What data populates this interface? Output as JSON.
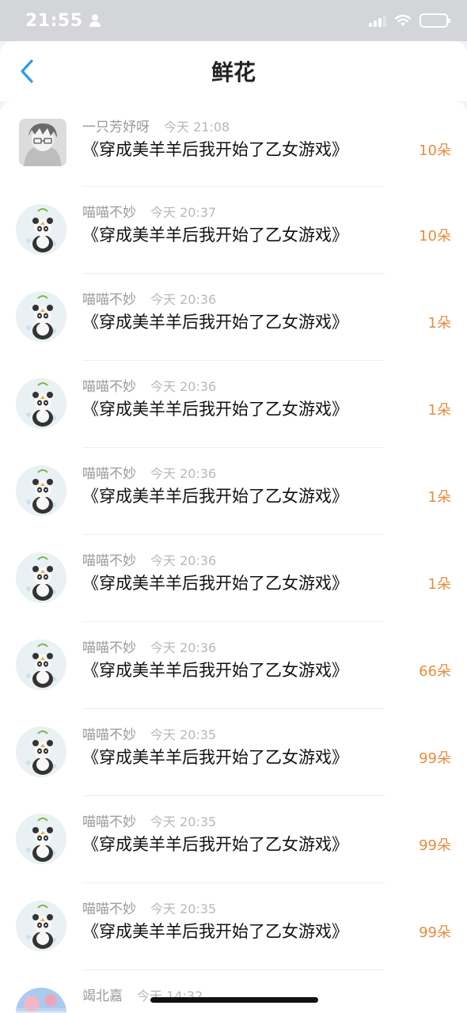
{
  "status_bar": {
    "time": "21:55",
    "battery_color": "#f5cc1b"
  },
  "nav": {
    "title": "鲜花",
    "back_icon": "chevron-left-icon",
    "accent": "#2b9cf0"
  },
  "items": [
    {
      "name": "一只芳妤呀",
      "time": "今天 21:08",
      "book": "《穿成美羊羊后我开始了乙女游戏》",
      "count": "10朵",
      "avatar": "anime-boy-avatar"
    },
    {
      "name": "喵喵不妙",
      "time": "今天 20:37",
      "book": "《穿成美羊羊后我开始了乙女游戏》",
      "count": "10朵",
      "avatar": "panda-avatar"
    },
    {
      "name": "喵喵不妙",
      "time": "今天 20:36",
      "book": "《穿成美羊羊后我开始了乙女游戏》",
      "count": "1朵",
      "avatar": "panda-avatar"
    },
    {
      "name": "喵喵不妙",
      "time": "今天 20:36",
      "book": "《穿成美羊羊后我开始了乙女游戏》",
      "count": "1朵",
      "avatar": "panda-avatar"
    },
    {
      "name": "喵喵不妙",
      "time": "今天 20:36",
      "book": "《穿成美羊羊后我开始了乙女游戏》",
      "count": "1朵",
      "avatar": "panda-avatar"
    },
    {
      "name": "喵喵不妙",
      "time": "今天 20:36",
      "book": "《穿成美羊羊后我开始了乙女游戏》",
      "count": "1朵",
      "avatar": "panda-avatar"
    },
    {
      "name": "喵喵不妙",
      "time": "今天 20:36",
      "book": "《穿成美羊羊后我开始了乙女游戏》",
      "count": "66朵",
      "avatar": "panda-avatar"
    },
    {
      "name": "喵喵不妙",
      "time": "今天 20:35",
      "book": "《穿成美羊羊后我开始了乙女游戏》",
      "count": "99朵",
      "avatar": "panda-avatar"
    },
    {
      "name": "喵喵不妙",
      "time": "今天 20:35",
      "book": "《穿成美羊羊后我开始了乙女游戏》",
      "count": "99朵",
      "avatar": "panda-avatar"
    },
    {
      "name": "喵喵不妙",
      "time": "今天 20:35",
      "book": "《穿成美羊羊后我开始了乙女游戏》",
      "count": "99朵",
      "avatar": "panda-avatar"
    },
    {
      "name": "竭北嘉",
      "time": "今天 14:32",
      "book": "",
      "count": "",
      "avatar": "scenery-avatar"
    }
  ],
  "colors": {
    "count": "#e58d3d",
    "meta": "#9a9a9a",
    "book": "#111111"
  }
}
